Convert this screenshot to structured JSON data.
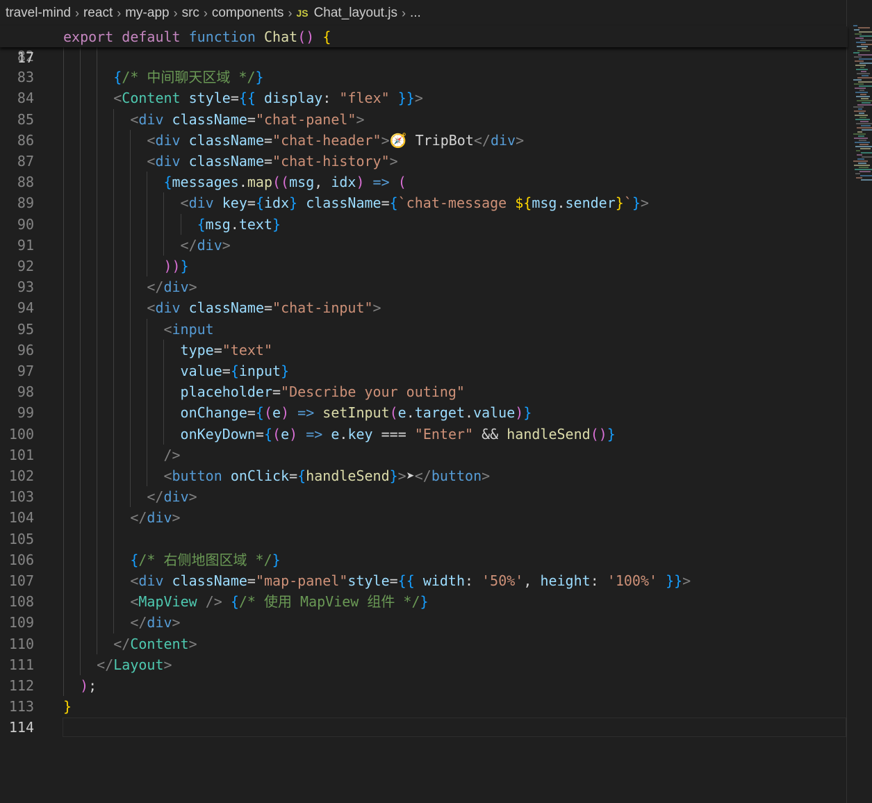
{
  "breadcrumb": {
    "items": [
      "travel-mind",
      "react",
      "my-app",
      "src",
      "components"
    ],
    "file_icon": "JS",
    "file": "Chat_layout.js",
    "more": "..."
  },
  "sticky": {
    "line": "17",
    "tokens": [
      [
        "export",
        "k"
      ],
      [
        " ",
        "o"
      ],
      [
        "default",
        "k"
      ],
      [
        " ",
        "o"
      ],
      [
        "function",
        "b"
      ],
      [
        " ",
        "o"
      ],
      [
        "Chat",
        "f"
      ],
      [
        "()",
        "pk"
      ],
      [
        " ",
        "o"
      ],
      [
        "{",
        "y"
      ]
    ]
  },
  "active_line": "114",
  "lines": [
    {
      "n": "82",
      "tokens": []
    },
    {
      "n": "83",
      "tokens": [
        [
          "{",
          "bl"
        ],
        [
          "/* 中间聊天区域 */",
          "m"
        ],
        [
          "}",
          "bl"
        ]
      ]
    },
    {
      "n": "84",
      "tokens": [
        [
          "<",
          "p"
        ],
        [
          "Content",
          "c"
        ],
        [
          " ",
          "o"
        ],
        [
          "style",
          "a"
        ],
        [
          "=",
          "o"
        ],
        [
          "{{",
          "bl"
        ],
        [
          " ",
          "o"
        ],
        [
          "display",
          "v"
        ],
        [
          ": ",
          "o"
        ],
        [
          "\"flex\"",
          "s"
        ],
        [
          " ",
          "o"
        ],
        [
          "}}",
          "bl"
        ],
        [
          ">",
          "p"
        ]
      ]
    },
    {
      "n": "85",
      "tokens": [
        [
          "<",
          "p"
        ],
        [
          "div",
          "t"
        ],
        [
          " ",
          "o"
        ],
        [
          "className",
          "a"
        ],
        [
          "=",
          "o"
        ],
        [
          "\"chat-panel\"",
          "s"
        ],
        [
          ">",
          "p"
        ]
      ]
    },
    {
      "n": "86",
      "tokens": [
        [
          "<",
          "p"
        ],
        [
          "div",
          "t"
        ],
        [
          " ",
          "o"
        ],
        [
          "className",
          "a"
        ],
        [
          "=",
          "o"
        ],
        [
          "\"chat-header\"",
          "s"
        ],
        [
          ">",
          "p"
        ],
        [
          "🧭 TripBot",
          "o"
        ],
        [
          "</",
          "p"
        ],
        [
          "div",
          "t"
        ],
        [
          ">",
          "p"
        ]
      ]
    },
    {
      "n": "87",
      "tokens": [
        [
          "<",
          "p"
        ],
        [
          "div",
          "t"
        ],
        [
          " ",
          "o"
        ],
        [
          "className",
          "a"
        ],
        [
          "=",
          "o"
        ],
        [
          "\"chat-history\"",
          "s"
        ],
        [
          ">",
          "p"
        ]
      ]
    },
    {
      "n": "88",
      "tokens": [
        [
          "{",
          "bl"
        ],
        [
          "messages",
          "v"
        ],
        [
          ".",
          "o"
        ],
        [
          "map",
          "f"
        ],
        [
          "((",
          "pk"
        ],
        [
          "msg",
          "v"
        ],
        [
          ", ",
          "o"
        ],
        [
          "idx",
          "v"
        ],
        [
          ")",
          "pk"
        ],
        [
          " ",
          "o"
        ],
        [
          "=>",
          "b"
        ],
        [
          " ",
          "o"
        ],
        [
          "(",
          "pk"
        ]
      ]
    },
    {
      "n": "89",
      "tokens": [
        [
          "<",
          "p"
        ],
        [
          "div",
          "t"
        ],
        [
          " ",
          "o"
        ],
        [
          "key",
          "a"
        ],
        [
          "=",
          "o"
        ],
        [
          "{",
          "bl"
        ],
        [
          "idx",
          "v"
        ],
        [
          "}",
          "bl"
        ],
        [
          " ",
          "o"
        ],
        [
          "className",
          "a"
        ],
        [
          "=",
          "o"
        ],
        [
          "{",
          "bl"
        ],
        [
          "`chat-message ",
          "s"
        ],
        [
          "${",
          "y"
        ],
        [
          "msg",
          "v"
        ],
        [
          ".",
          "o"
        ],
        [
          "sender",
          "v"
        ],
        [
          "}",
          "y"
        ],
        [
          "`",
          "s"
        ],
        [
          "}",
          "bl"
        ],
        [
          ">",
          "p"
        ]
      ]
    },
    {
      "n": "90",
      "tokens": [
        [
          "{",
          "bl"
        ],
        [
          "msg",
          "v"
        ],
        [
          ".",
          "o"
        ],
        [
          "text",
          "v"
        ],
        [
          "}",
          "bl"
        ]
      ]
    },
    {
      "n": "91",
      "tokens": [
        [
          "</",
          "p"
        ],
        [
          "div",
          "t"
        ],
        [
          ">",
          "p"
        ]
      ]
    },
    {
      "n": "92",
      "tokens": [
        [
          "))",
          "pk"
        ],
        [
          "}",
          "bl"
        ]
      ]
    },
    {
      "n": "93",
      "tokens": [
        [
          "</",
          "p"
        ],
        [
          "div",
          "t"
        ],
        [
          ">",
          "p"
        ]
      ]
    },
    {
      "n": "94",
      "tokens": [
        [
          "<",
          "p"
        ],
        [
          "div",
          "t"
        ],
        [
          " ",
          "o"
        ],
        [
          "className",
          "a"
        ],
        [
          "=",
          "o"
        ],
        [
          "\"chat-input\"",
          "s"
        ],
        [
          ">",
          "p"
        ]
      ]
    },
    {
      "n": "95",
      "tokens": [
        [
          "<",
          "p"
        ],
        [
          "input",
          "t"
        ]
      ]
    },
    {
      "n": "96",
      "tokens": [
        [
          "type",
          "a"
        ],
        [
          "=",
          "o"
        ],
        [
          "\"text\"",
          "s"
        ]
      ]
    },
    {
      "n": "97",
      "tokens": [
        [
          "value",
          "a"
        ],
        [
          "=",
          "o"
        ],
        [
          "{",
          "bl"
        ],
        [
          "input",
          "v"
        ],
        [
          "}",
          "bl"
        ]
      ]
    },
    {
      "n": "98",
      "tokens": [
        [
          "placeholder",
          "a"
        ],
        [
          "=",
          "o"
        ],
        [
          "\"Describe your outing\"",
          "s"
        ]
      ]
    },
    {
      "n": "99",
      "tokens": [
        [
          "onChange",
          "a"
        ],
        [
          "=",
          "o"
        ],
        [
          "{",
          "bl"
        ],
        [
          "(",
          "pk"
        ],
        [
          "e",
          "v"
        ],
        [
          ")",
          "pk"
        ],
        [
          " ",
          "o"
        ],
        [
          "=>",
          "b"
        ],
        [
          " ",
          "o"
        ],
        [
          "setInput",
          "f"
        ],
        [
          "(",
          "pk"
        ],
        [
          "e",
          "v"
        ],
        [
          ".",
          "o"
        ],
        [
          "target",
          "v"
        ],
        [
          ".",
          "o"
        ],
        [
          "value",
          "v"
        ],
        [
          ")",
          "pk"
        ],
        [
          "}",
          "bl"
        ]
      ]
    },
    {
      "n": "100",
      "tokens": [
        [
          "onKeyDown",
          "a"
        ],
        [
          "=",
          "o"
        ],
        [
          "{",
          "bl"
        ],
        [
          "(",
          "pk"
        ],
        [
          "e",
          "v"
        ],
        [
          ")",
          "pk"
        ],
        [
          " ",
          "o"
        ],
        [
          "=>",
          "b"
        ],
        [
          " ",
          "o"
        ],
        [
          "e",
          "v"
        ],
        [
          ".",
          "o"
        ],
        [
          "key",
          "v"
        ],
        [
          " ",
          "o"
        ],
        [
          "===",
          "o"
        ],
        [
          " ",
          "o"
        ],
        [
          "\"Enter\"",
          "s"
        ],
        [
          " ",
          "o"
        ],
        [
          "&&",
          "o"
        ],
        [
          " ",
          "o"
        ],
        [
          "handleSend",
          "f"
        ],
        [
          "()",
          "pk"
        ],
        [
          "}",
          "bl"
        ]
      ]
    },
    {
      "n": "101",
      "tokens": [
        [
          "/>",
          "p"
        ]
      ]
    },
    {
      "n": "102",
      "tokens": [
        [
          "<",
          "p"
        ],
        [
          "button",
          "t"
        ],
        [
          " ",
          "o"
        ],
        [
          "onClick",
          "a"
        ],
        [
          "=",
          "o"
        ],
        [
          "{",
          "bl"
        ],
        [
          "handleSend",
          "f"
        ],
        [
          "}",
          "bl"
        ],
        [
          ">",
          "p"
        ],
        [
          "➤",
          "o"
        ],
        [
          "</",
          "p"
        ],
        [
          "button",
          "t"
        ],
        [
          ">",
          "p"
        ]
      ]
    },
    {
      "n": "103",
      "tokens": [
        [
          "</",
          "p"
        ],
        [
          "div",
          "t"
        ],
        [
          ">",
          "p"
        ]
      ]
    },
    {
      "n": "104",
      "tokens": [
        [
          "</",
          "p"
        ],
        [
          "div",
          "t"
        ],
        [
          ">",
          "p"
        ]
      ]
    },
    {
      "n": "105",
      "tokens": []
    },
    {
      "n": "106",
      "tokens": [
        [
          "{",
          "bl"
        ],
        [
          "/* 右侧地图区域 */",
          "m"
        ],
        [
          "}",
          "bl"
        ]
      ]
    },
    {
      "n": "107",
      "tokens": [
        [
          "<",
          "p"
        ],
        [
          "div",
          "t"
        ],
        [
          " ",
          "o"
        ],
        [
          "className",
          "a"
        ],
        [
          "=",
          "o"
        ],
        [
          "\"map-panel\"",
          "s"
        ],
        [
          "style",
          "a"
        ],
        [
          "=",
          "o"
        ],
        [
          "{{",
          "bl"
        ],
        [
          " ",
          "o"
        ],
        [
          "width",
          "v"
        ],
        [
          ": ",
          "o"
        ],
        [
          "'50%'",
          "s"
        ],
        [
          ", ",
          "o"
        ],
        [
          "height",
          "v"
        ],
        [
          ": ",
          "o"
        ],
        [
          "'100%'",
          "s"
        ],
        [
          " ",
          "o"
        ],
        [
          "}}",
          "bl"
        ],
        [
          ">",
          "p"
        ]
      ]
    },
    {
      "n": "108",
      "tokens": [
        [
          "<",
          "p"
        ],
        [
          "MapView",
          "c"
        ],
        [
          " ",
          "o"
        ],
        [
          "/>",
          "p"
        ],
        [
          " ",
          "o"
        ],
        [
          "{",
          "bl"
        ],
        [
          "/* 使用 MapView 组件 */",
          "m"
        ],
        [
          "}",
          "bl"
        ]
      ]
    },
    {
      "n": "109",
      "tokens": [
        [
          "</",
          "p"
        ],
        [
          "div",
          "t"
        ],
        [
          ">",
          "p"
        ]
      ]
    },
    {
      "n": "110",
      "tokens": [
        [
          "</",
          "p"
        ],
        [
          "Content",
          "c"
        ],
        [
          ">",
          "p"
        ]
      ]
    },
    {
      "n": "111",
      "tokens": [
        [
          "</",
          "p"
        ],
        [
          "Layout",
          "c"
        ],
        [
          ">",
          "p"
        ]
      ]
    },
    {
      "n": "112",
      "tokens": [
        [
          ")",
          "pk"
        ],
        [
          ";",
          "o"
        ]
      ]
    },
    {
      "n": "113",
      "tokens": [
        [
          "}",
          "y"
        ]
      ]
    },
    {
      "n": "114",
      "tokens": []
    }
  ]
}
